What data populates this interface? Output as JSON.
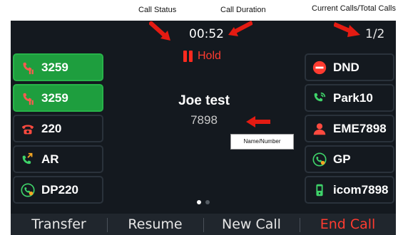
{
  "annotations": {
    "call_status": "Call Status",
    "call_duration": "Call Duration",
    "current_calls": "Current Calls/Total Calls",
    "name_number": "Name/Number"
  },
  "call": {
    "duration": "00:52",
    "counter": "1/2",
    "status": "Hold",
    "name": "Joe test",
    "number": "7898"
  },
  "left_keys": [
    {
      "label": "3259",
      "icon": "call-hold-icon",
      "active": true
    },
    {
      "label": "3259",
      "icon": "call-hold-icon",
      "active": true
    },
    {
      "label": "220",
      "icon": "phone-busy-icon",
      "active": false
    },
    {
      "label": "AR",
      "icon": "call-forward-icon",
      "active": false
    },
    {
      "label": "DP220",
      "icon": "speed-dial-icon",
      "active": false
    }
  ],
  "right_keys": [
    {
      "label": "DND",
      "icon": "dnd-icon"
    },
    {
      "label": "Park10",
      "icon": "call-park-icon"
    },
    {
      "label": "EME7898",
      "icon": "contact-icon"
    },
    {
      "label": "GP",
      "icon": "group-pickup-icon"
    },
    {
      "label": "icom7898",
      "icon": "intercom-icon"
    }
  ],
  "page_indicator": {
    "current": 1,
    "total": 2
  },
  "softkeys": {
    "transfer": "Transfer",
    "resume": "Resume",
    "new_call": "New Call",
    "end_call": "End Call"
  },
  "colors": {
    "screen_bg": "#14191f",
    "key_active": "#1e9e3e",
    "hold_red": "#ff3b30",
    "annotation_arrow": "#e41b12"
  }
}
